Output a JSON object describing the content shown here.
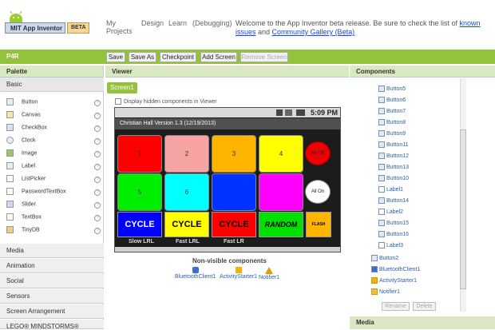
{
  "header": {
    "logo_text": "MIT App Inventor",
    "beta_badge": "BETA",
    "nav": [
      "My Projects",
      "Design",
      "Learn",
      "(Debugging)"
    ],
    "welcome_prefix": "Welcome to the App Inventor beta release. Be sure to check the list of ",
    "known_issues": "known issues",
    "welcome_and": " and ",
    "community_gallery": "Community Gallery (Beta)"
  },
  "toolbar": {
    "project_name": "P4R",
    "buttons": [
      "Save",
      "Save As",
      "Checkpoint",
      "Add Screen",
      "Remove Screen"
    ]
  },
  "palette": {
    "title": "Palette",
    "basic": "Basic",
    "items": [
      "Button",
      "Canvas",
      "CheckBox",
      "Clock",
      "Image",
      "Label",
      "ListPicker",
      "PasswordTextBox",
      "Slider",
      "TextBox",
      "TinyDB"
    ],
    "help": "?",
    "sections": [
      "Media",
      "Animation",
      "Social",
      "Sensors",
      "Screen Arrangement",
      "LEGO® MINDSTORMS®"
    ]
  },
  "viewer": {
    "title": "Viewer",
    "screen_tab": "Screen1",
    "hidden_label": "Display hidden components in Viewer",
    "status_time": "5:09 PM",
    "app_title": "Christian Hall Version 1.3 (12/19/2013)",
    "grid_buttons": [
      {
        "label": "1",
        "color": "#ff0000"
      },
      {
        "label": "2",
        "color": "#f7a3a3"
      },
      {
        "label": "3",
        "color": "#ffb400"
      },
      {
        "label": "4",
        "color": "#ffff00"
      },
      {
        "label": "5",
        "color": "#00ee00"
      },
      {
        "label": "6",
        "color": "#00ffff"
      },
      {
        "label": "",
        "color": "#0033ff"
      },
      {
        "label": "",
        "color": "#ff00ff"
      }
    ],
    "all_off": "All Off",
    "all_on": "All On",
    "cycle_buttons": [
      {
        "label": "CYCLE",
        "bg": "#0000ff",
        "fg": "#ffffff"
      },
      {
        "label": "CYCLE",
        "bg": "#ffff00",
        "fg": "#000000"
      },
      {
        "label": "CYCLE",
        "bg": "#ff0000",
        "fg": "#000000"
      },
      {
        "label": "RANDOM",
        "bg": "#00e000",
        "fg": "#000000"
      },
      {
        "label": "FLASH",
        "bg": "#ffb400",
        "fg": "#000000"
      }
    ],
    "speed_labels": [
      "Slow LRL",
      "Fast LRL",
      "Fast LR"
    ],
    "nonvisible_title": "Non-visible components",
    "nonvisible": [
      "BluetoothClient1",
      "ActivityStarter1",
      "Notifier1"
    ]
  },
  "components": {
    "title": "Components",
    "tree": [
      "Button5",
      "Button6",
      "Button7",
      "Button8",
      "Button9",
      "Button11",
      "Button12",
      "Button13",
      "Button10",
      "Label1",
      "Button14",
      "Label2",
      "Button15",
      "Button16",
      "Label3"
    ],
    "root_items": [
      "Button2",
      "BluetoothClient1",
      "ActivityStarter1",
      "Notifier1"
    ],
    "rename": "Rename",
    "delete": "Delete",
    "media": "Media"
  }
}
